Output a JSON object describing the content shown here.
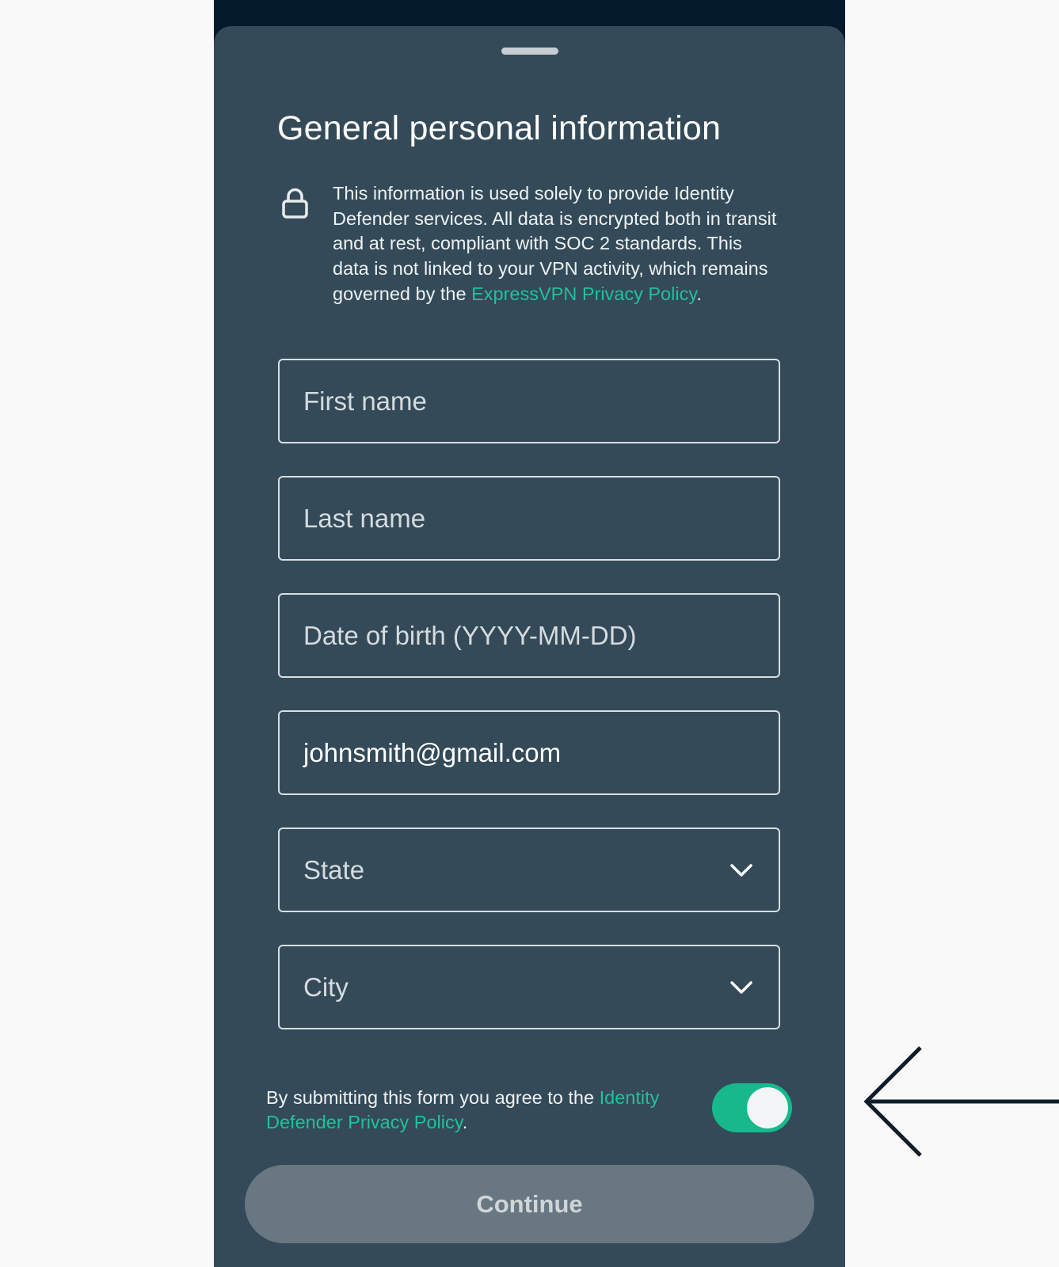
{
  "sheet": {
    "title": "General personal information",
    "notice": {
      "icon": "lock-icon",
      "text": "This information is used solely to provide Identity Defender services. All data is encrypted both in transit and at rest, compliant with SOC 2 standards. This data is not linked to your VPN activity, which remains governed by the ",
      "link_label": "ExpressVPN Privacy Policy",
      "suffix": "."
    },
    "fields": {
      "first_name": {
        "placeholder": "First name",
        "value": ""
      },
      "last_name": {
        "placeholder": "Last name",
        "value": ""
      },
      "dob": {
        "placeholder": "Date of birth (YYYY-MM-DD)",
        "value": ""
      },
      "email": {
        "placeholder": "",
        "value": "johnsmith@gmail.com"
      },
      "state": {
        "placeholder": "State",
        "icon": "chevron-down-icon"
      },
      "city": {
        "placeholder": "City",
        "icon": "chevron-down-icon"
      }
    },
    "consent": {
      "text": "By submitting this form you agree to the ",
      "link_label": "Identity Defender Privacy Policy",
      "suffix": ".",
      "toggle_on": true
    },
    "continue_label": "Continue"
  },
  "colors": {
    "sheet_bg": "#344a58",
    "accent": "#1fc29b",
    "toggle_on": "#17b98c",
    "button_disabled": "#687781"
  },
  "annotation": {
    "icon": "left-arrow-icon"
  }
}
